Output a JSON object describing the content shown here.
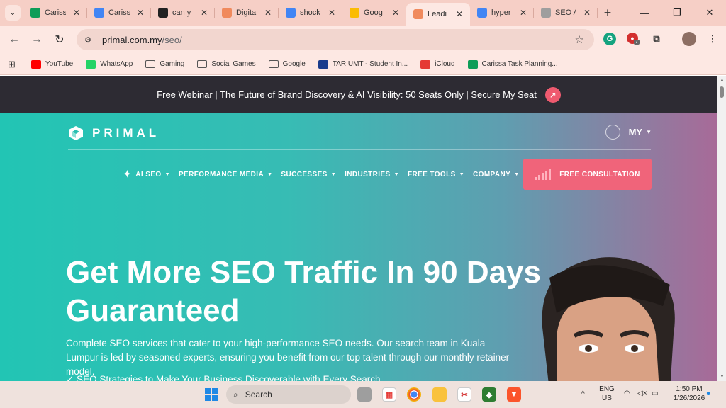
{
  "browser": {
    "tabs": [
      {
        "title": "Cariss",
        "icon": "sheets-icon",
        "color": "#0f9d58",
        "active": false
      },
      {
        "title": "Cariss",
        "icon": "docs-icon",
        "color": "#4285f4",
        "active": false
      },
      {
        "title": "can y",
        "icon": "chatgpt-icon",
        "color": "#222222",
        "active": false
      },
      {
        "title": "Digita",
        "icon": "primal-icon",
        "color": "#f08a5d",
        "active": false
      },
      {
        "title": "shock",
        "icon": "google-icon",
        "color": "#4285f4",
        "active": false
      },
      {
        "title": "Goog",
        "icon": "keep-icon",
        "color": "#fbbc04",
        "active": false
      },
      {
        "title": "Leadi",
        "icon": "primal-icon",
        "color": "#f08a5d",
        "active": true
      },
      {
        "title": "hyper",
        "icon": "google-icon",
        "color": "#4285f4",
        "active": false
      },
      {
        "title": "SEO A",
        "icon": "openai-icon",
        "color": "#9e9e9e",
        "active": false
      }
    ],
    "new_tab_label": "+",
    "url_host": "primal.com.my",
    "url_path": "/seo/",
    "extension_badge": "7",
    "bookmarks": [
      {
        "label": "YouTube",
        "icon": "youtube-icon",
        "color": "#ff0000"
      },
      {
        "label": "WhatsApp",
        "icon": "whatsapp-icon",
        "color": "#25d366"
      },
      {
        "label": "Gaming",
        "icon": "folder-icon",
        "color": "#555555"
      },
      {
        "label": "Social Games",
        "icon": "folder-icon",
        "color": "#555555"
      },
      {
        "label": "Google",
        "icon": "folder-icon",
        "color": "#555555"
      },
      {
        "label": "TAR UMT - Student In...",
        "icon": "tarumt-icon",
        "color": "#1a3c8c"
      },
      {
        "label": "iCloud",
        "icon": "icloud-icon",
        "color": "#e53935"
      },
      {
        "label": "Carissa Task Planning...",
        "icon": "sheets-icon",
        "color": "#0f9d58"
      }
    ]
  },
  "site": {
    "banner": {
      "text": "Free Webinar | The Future of Brand Discovery & AI Visibility: 50 Seats Only | Secure My Seat",
      "arrow": "↗"
    },
    "logo_text": "PRIMAL",
    "region": "MY",
    "nav": [
      {
        "label": "AI SEO",
        "has_sparkle": true
      },
      {
        "label": "PERFORMANCE MEDIA",
        "has_sparkle": false
      },
      {
        "label": "SUCCESSES",
        "has_sparkle": false
      },
      {
        "label": "INDUSTRIES",
        "has_sparkle": false
      },
      {
        "label": "FREE TOOLS",
        "has_sparkle": false
      },
      {
        "label": "COMPANY",
        "has_sparkle": false
      }
    ],
    "cta_label": "FREE CONSULTATION",
    "hero": {
      "title_line1": "Get More SEO Traffic In 90 Days",
      "title_line2": "Guaranteed",
      "description": "Complete SEO services that cater to your high-performance SEO needs. Our search team in Kuala Lumpur is led by seasoned experts, ensuring you benefit from our top talent through our monthly retainer model.",
      "bullet": "✓ SEO Strategies to Make Your Business Discoverable with Every Search"
    },
    "colors": {
      "accent": "#f0647a",
      "banner_bg": "#2d2b33",
      "teal": "#22c5b4"
    }
  },
  "taskbar": {
    "search_placeholder": "Search",
    "lang_line1": "ENG",
    "lang_line2": "US",
    "time": "1:50 PM",
    "date": "1/26/2026"
  }
}
